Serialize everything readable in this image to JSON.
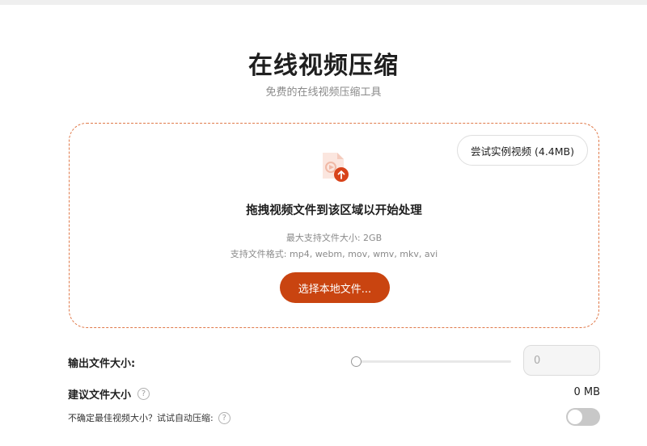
{
  "header": {
    "title": "在线视频压缩",
    "subtitle": "免费的在线视频压缩工具"
  },
  "dropzone": {
    "sample_button": "尝试实例视频 (4.4MB)",
    "drop_text": "拖拽视频文件到该区域以开始处理",
    "max_size": "最大支持文件大小: 2GB",
    "formats": "支持文件格式: mp4, webm, mov, wmv, mkv, avi",
    "choose_button": "选择本地文件..."
  },
  "settings": {
    "output_size_label": "输出文件大小:",
    "output_size_value": "0",
    "slider_fraction": 0,
    "suggested_size_label": "建议文件大小",
    "suggested_size_value": "0 MB",
    "auto_compress_label": "不确定最佳视频大小？试试自动压缩:",
    "auto_compress_on": false
  },
  "colors": {
    "accent": "#c94410",
    "dropzone_border": "#e07a4a"
  },
  "icons": {
    "upload": "video-file-upload-icon",
    "help": "question-circle-icon"
  }
}
